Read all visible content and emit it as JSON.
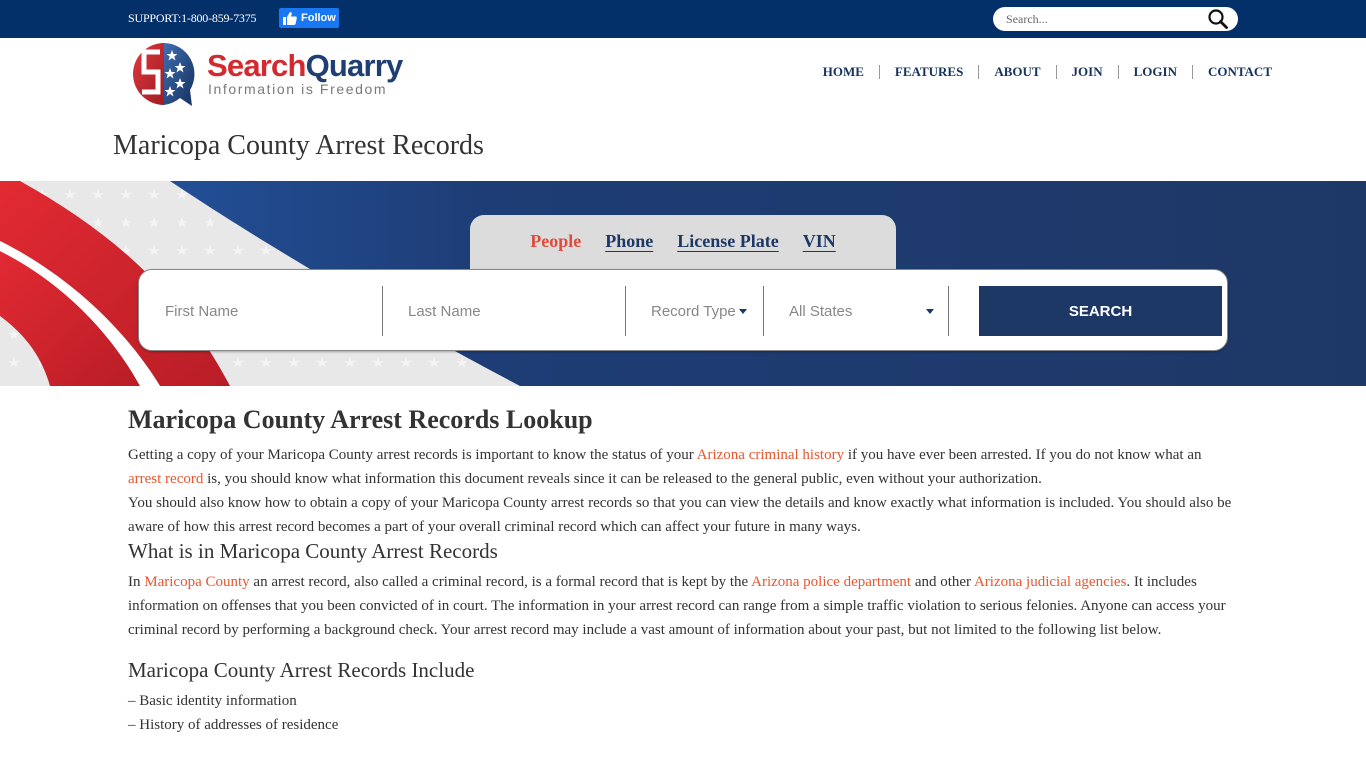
{
  "topbar": {
    "support_text": "SUPPORT:1-800-859-7375",
    "follow_label": "Follow",
    "search_placeholder": "Search..."
  },
  "logo": {
    "name_part1": "Search",
    "name_part2": "Quarry",
    "tagline": "Information is Freedom"
  },
  "nav": {
    "items": [
      {
        "label": "HOME"
      },
      {
        "label": "FEATURES"
      },
      {
        "label": "ABOUT"
      },
      {
        "label": "JOIN"
      },
      {
        "label": "LOGIN"
      },
      {
        "label": "CONTACT"
      }
    ]
  },
  "page_title": "Maricopa County Arrest Records",
  "search_widget": {
    "tabs": [
      {
        "label": "People",
        "active": true
      },
      {
        "label": "Phone",
        "active": false
      },
      {
        "label": "License Plate",
        "active": false
      },
      {
        "label": "VIN",
        "active": false
      }
    ],
    "first_name_placeholder": "First Name",
    "last_name_placeholder": "Last Name",
    "record_type_value": "Record Type",
    "state_value": "All States",
    "search_label": "SEARCH"
  },
  "colors": {
    "topbar": "#04306a",
    "navy": "#1e3866",
    "accent_red": "#e04b3c",
    "link_orange": "#e8572f"
  },
  "content": {
    "heading": "Maricopa County Arrest Records Lookup",
    "p1": {
      "t1": "Getting a copy of your Maricopa County arrest records is important to know the status of your ",
      "link1": "Arizona criminal history",
      "t2": " if you have ever been arrested. If you do not know what an ",
      "link2": "arrest record",
      "t3": " is, you should know what information this document reveals since it can be released to the general public, even without your authorization."
    },
    "p2": "You should also know how to obtain a copy of your Maricopa County arrest records so that you can view the details and know exactly what information is included. You should also be aware of how this arrest record becomes a part of your overall criminal record which can affect your future in many ways.",
    "subheading1": "What is in Maricopa County Arrest Records",
    "p3": {
      "t1": "In ",
      "link1": "Maricopa County",
      "t2": " an arrest record, also called a criminal record, is a formal record that is kept by the ",
      "link2": "Arizona police department",
      "t3": " and other ",
      "link3": "Arizona judicial agencies",
      "t4": ". It includes information on offenses that you been convicted of in court. The information in your arrest record can range from a simple traffic violation to serious felonies. Anyone can access your criminal record by performing a background check. Your arrest record may include a vast amount of information about your past, but not limited to the following list below."
    },
    "subheading2": "Maricopa County Arrest Records Include",
    "list": [
      "– Basic identity information",
      "– History of addresses of residence"
    ]
  }
}
